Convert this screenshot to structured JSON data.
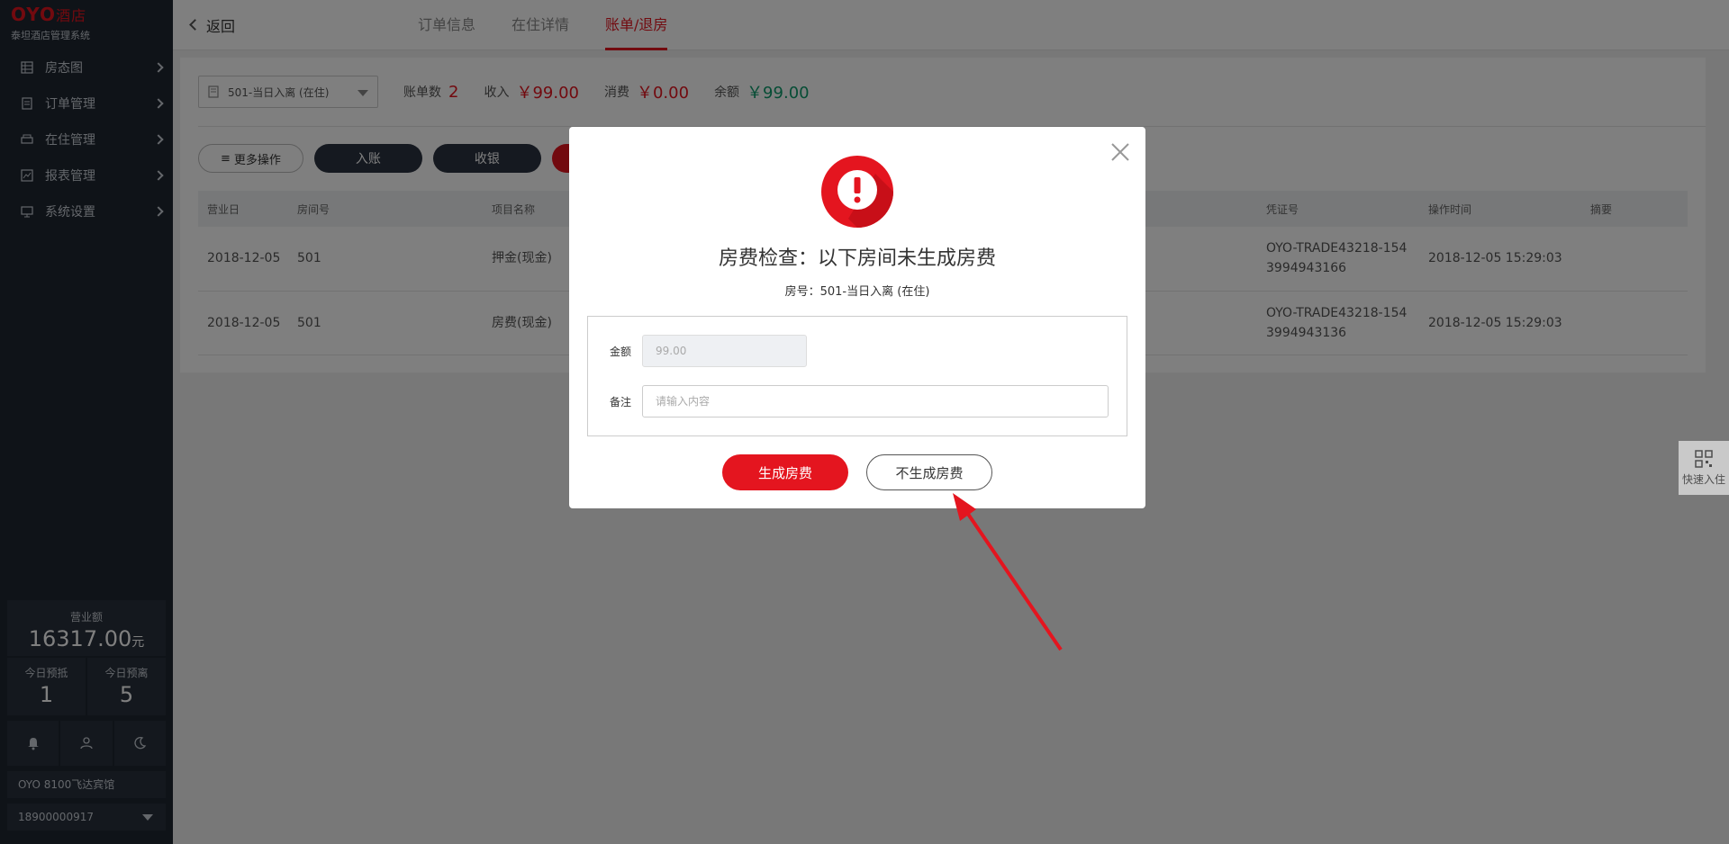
{
  "sidebar": {
    "brand": "OYO",
    "brand_suffix": "酒店",
    "system_name": "泰坦酒店管理系统",
    "menu": [
      {
        "label": "房态图",
        "icon": "grid-icon"
      },
      {
        "label": "订单管理",
        "icon": "list-icon"
      },
      {
        "label": "在住管理",
        "icon": "bed-icon"
      },
      {
        "label": "报表管理",
        "icon": "chart-icon"
      },
      {
        "label": "系统设置",
        "icon": "monitor-icon"
      }
    ],
    "revenue_label": "营业额",
    "revenue_value": "16317.00",
    "revenue_unit": "元",
    "arrive_label": "今日预抵",
    "arrive_value": "1",
    "depart_label": "今日预离",
    "depart_value": "5",
    "hotel_name": "OYO 8100飞达宾馆",
    "phone": "18900000917"
  },
  "header": {
    "back_label": "返回",
    "tabs": [
      {
        "label": "订单信息",
        "active": false
      },
      {
        "label": "在住详情",
        "active": false
      },
      {
        "label": "账单/退房",
        "active": true
      }
    ]
  },
  "bill": {
    "room_select": "501-当日入离 (在住)",
    "count_label": "账单数",
    "count_value": "2",
    "income_label": "收入",
    "income_value": "￥99.00",
    "consume_label": "消费",
    "consume_value": "￥0.00",
    "balance_label": "余额",
    "balance_value": "￥99.00",
    "more_label": "更多操作",
    "post_label": "入账",
    "cashier_label": "收银"
  },
  "table": {
    "headers": [
      "营业日",
      "房间号",
      "项目名称",
      "",
      "凭证号",
      "操作时间",
      "摘要"
    ],
    "rows": [
      {
        "date": "2018-12-05",
        "room": "501",
        "item": "押金(现金)",
        "voucher_1": "OYO-TRADE43218-154",
        "voucher_2": "3994943166",
        "time": "2018-12-05 15:29:03"
      },
      {
        "date": "2018-12-05",
        "room": "501",
        "item": "房费(现金)",
        "voucher_1": "OYO-TRADE43218-154",
        "voucher_2": "3994943136",
        "time": "2018-12-05 15:29:03"
      }
    ]
  },
  "quick": {
    "label": "快速入住"
  },
  "modal": {
    "title": "房费检查：以下房间未生成房费",
    "subtitle": "房号：501-当日入离 (在住)",
    "amount_label": "金额",
    "amount_value": "99.00",
    "remark_label": "备注",
    "remark_placeholder": "请输入内容",
    "confirm_label": "生成房费",
    "cancel_label": "不生成房费"
  },
  "colors": {
    "accent": "#e4151f",
    "sidebar": "#1e2630",
    "green": "#0c9a6b"
  }
}
